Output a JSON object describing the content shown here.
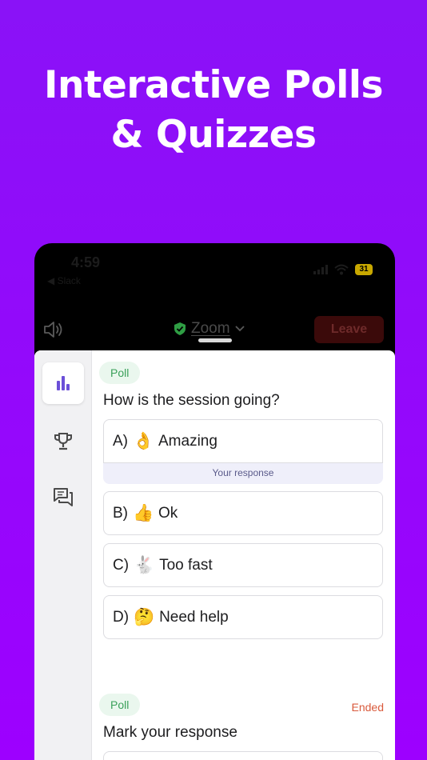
{
  "headline": {
    "line1": "Interactive Polls",
    "line2": "& Quizzes"
  },
  "status_bar": {
    "time": "4:59",
    "back_label": "◀ Slack",
    "battery": "31"
  },
  "call_bar": {
    "app_name": "Zoom",
    "leave_label": "Leave"
  },
  "sidebar": {
    "items": [
      {
        "icon": "bar-chart-icon",
        "active": true
      },
      {
        "icon": "trophy-icon",
        "active": false
      },
      {
        "icon": "chat-icon",
        "active": false
      }
    ]
  },
  "polls": [
    {
      "badge": "Poll",
      "question": "How is the session going?",
      "options": [
        {
          "letter": "A)",
          "emoji": "👌",
          "text": "Amazing",
          "selected": true
        },
        {
          "letter": "B)",
          "emoji": "👍",
          "text": "Ok",
          "selected": false
        },
        {
          "letter": "C)",
          "emoji": "🐇",
          "text": "Too fast",
          "selected": false
        },
        {
          "letter": "D)",
          "emoji": "🤔",
          "text": "Need help",
          "selected": false
        }
      ],
      "response_label": "Your response"
    },
    {
      "badge": "Poll",
      "status": "Ended",
      "question": "Mark your response"
    }
  ],
  "colors": {
    "background": "#9d00ff",
    "badge_bg": "#eaf7ee",
    "badge_text": "#3aa05a",
    "ended": "#d95a3c",
    "accent": "#6b4fd8",
    "shield": "#2f9e44"
  }
}
